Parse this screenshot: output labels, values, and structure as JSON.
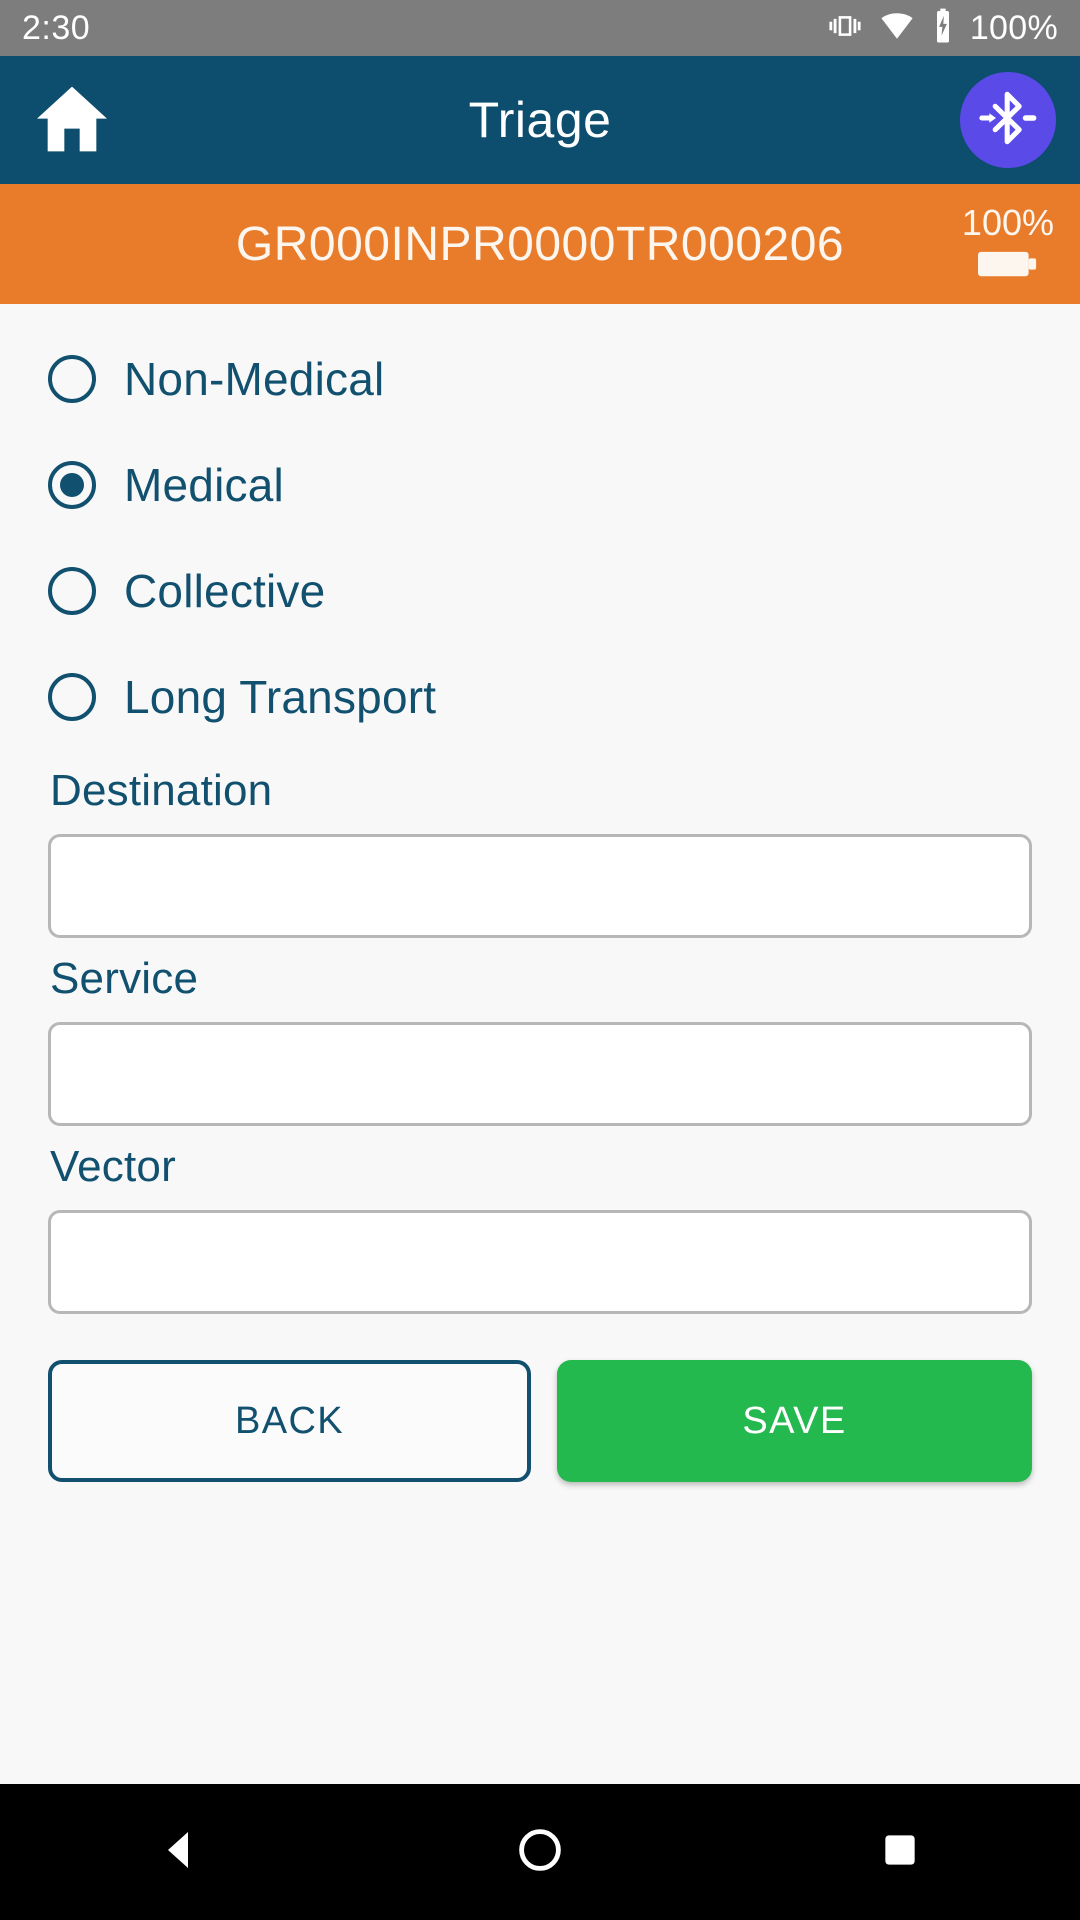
{
  "status_bar": {
    "time": "2:30",
    "battery_percent": "100%",
    "icons": [
      "vibrate-icon",
      "wifi-icon",
      "battery-charging-icon"
    ]
  },
  "app_bar": {
    "title": "Triage",
    "home_icon": "home-icon",
    "bluetooth_icon": "bluetooth-connected-icon",
    "bluetooth_color": "#5a4ae8",
    "background": "#0d4d6e"
  },
  "banner": {
    "patient_id": "GR000INPR0000TR000206",
    "battery_percent": "100%",
    "battery_icon": "battery-full-icon",
    "background": "#e87c2a"
  },
  "radio_group": {
    "name": "triage-type",
    "options": [
      {
        "label": "Non-Medical",
        "selected": false
      },
      {
        "label": "Medical",
        "selected": true
      },
      {
        "label": "Collective",
        "selected": false
      },
      {
        "label": "Long Transport",
        "selected": false
      }
    ]
  },
  "fields": [
    {
      "label": "Destination",
      "value": "",
      "placeholder": ""
    },
    {
      "label": "Service",
      "value": "",
      "placeholder": ""
    },
    {
      "label": "Vector",
      "value": "",
      "placeholder": ""
    }
  ],
  "actions": {
    "back_label": "BACK",
    "save_label": "SAVE",
    "save_color": "#23b94e",
    "accent_color": "#12506f"
  },
  "nav_bar": {
    "back_icon": "triangle-back-icon",
    "home_icon": "circle-home-icon",
    "recents_icon": "square-recents-icon"
  }
}
